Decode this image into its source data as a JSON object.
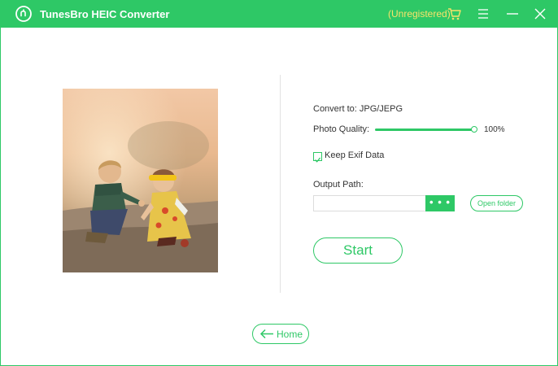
{
  "app": {
    "title": "TunesBro HEIC Converter",
    "status": "(Unregistered)",
    "brand_color": "#2ec866",
    "status_color": "#f7e36a"
  },
  "window_controls": {
    "cart": "cart-icon",
    "menu": "menu-icon",
    "minimize": "minimize-icon",
    "close": "close-icon"
  },
  "settings": {
    "convert_to": "Convert to: JPG/JEPG",
    "photo_quality_label": "Photo Quality:",
    "photo_quality_value": "100%",
    "photo_quality_fraction": 1.0,
    "keep_exif_label": "Keep Exif Data",
    "keep_exif_checked": true,
    "output_path_label": "Output Path:",
    "output_path_value": "",
    "browse_label": "• • •",
    "open_folder_label": "Open folder"
  },
  "actions": {
    "start_label": "Start",
    "home_label": "Home"
  }
}
